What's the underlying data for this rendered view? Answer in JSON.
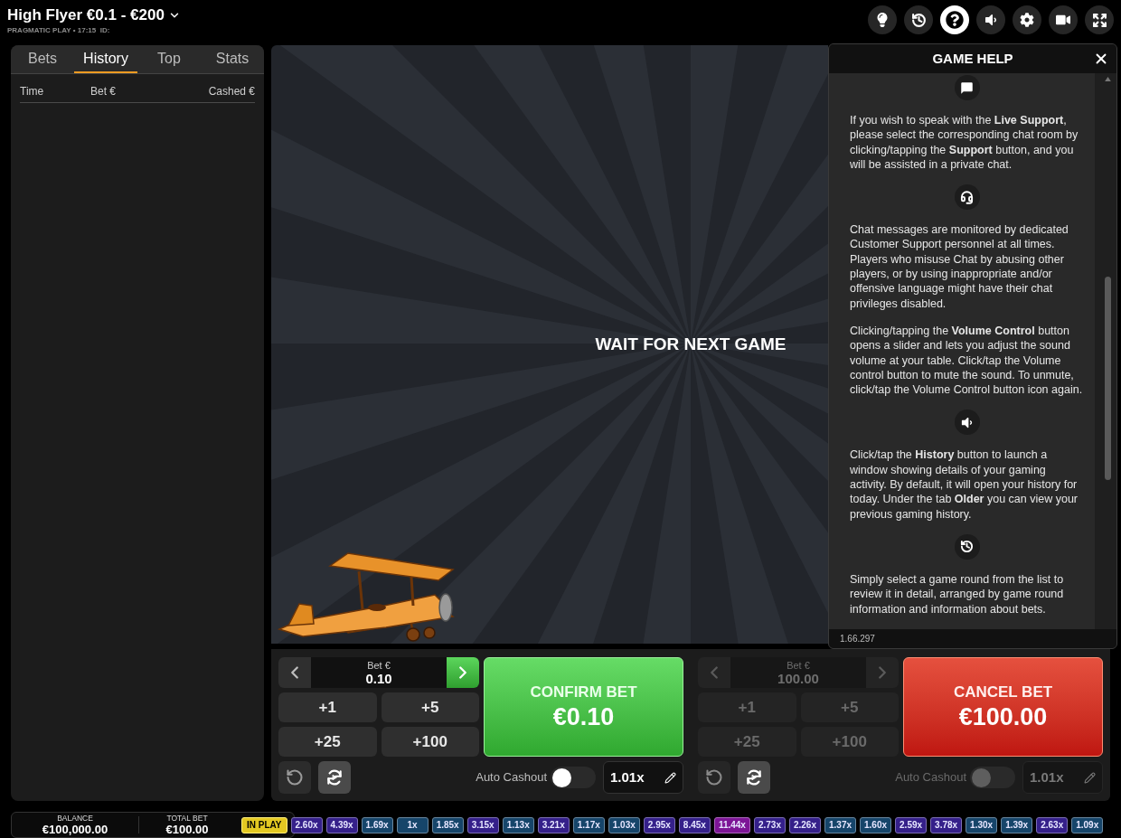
{
  "header": {
    "title": "High Flyer €0.1 - €200",
    "subtitle": "PRAGMATIC PLAY • 17:15  ID:"
  },
  "toolbar": [
    {
      "kind": "tips",
      "selected": false
    },
    {
      "kind": "history",
      "selected": false
    },
    {
      "kind": "help",
      "selected": true
    },
    {
      "kind": "sound",
      "selected": false
    },
    {
      "kind": "settings",
      "selected": false
    },
    {
      "kind": "video",
      "selected": false
    },
    {
      "kind": "fullscreen",
      "selected": false
    }
  ],
  "bets_panel": {
    "tabs": [
      {
        "label": "Bets",
        "selected": false
      },
      {
        "label": "History",
        "selected": true
      },
      {
        "label": "Top",
        "selected": false
      },
      {
        "label": "Stats",
        "selected": false
      }
    ],
    "columns": [
      "Time",
      "Bet €",
      "Cashed €"
    ]
  },
  "game": {
    "status": "WAIT FOR NEXT GAME"
  },
  "help": {
    "title": "GAME HELP",
    "items": [
      {
        "kind": "chat"
      },
      {
        "kind": "text",
        "text": "If you wish to speak with the **Live Support**, please select the corresponding chat room by clicking/tapping the **Support** button, and you will be assisted in a private chat."
      },
      {
        "kind": "support"
      },
      {
        "kind": "text",
        "text": "Chat messages are monitored by dedicated Customer Support personnel at all times. Players who misuse Chat by abusing other players, or by using inappropriate and/or offensive language might have their chat privileges disabled."
      },
      {
        "kind": "text",
        "text": "Clicking/tapping the **Volume Control** button opens a slider and lets you adjust the sound volume at your table. Click/tap the Volume control button to mute the sound. To unmute, click/tap the Volume Control button icon again."
      },
      {
        "kind": "sound"
      },
      {
        "kind": "text",
        "text": "Click/tap the **History** button to launch a window showing details of your gaming activity. By default, it will open your history for today. Under the tab **Older** you can view your previous gaming history."
      },
      {
        "kind": "history"
      },
      {
        "kind": "text",
        "text": "Simply select a game round from the list to review it in detail, arranged by game round information and information about bets."
      }
    ],
    "version": "1.66.297"
  },
  "bet_panels": [
    {
      "disabled": false,
      "stepper": {
        "label": "Bet €",
        "value": "0.10",
        "increase_highlighted": true
      },
      "chips": [
        "+1",
        "+5",
        "+25",
        "+100"
      ],
      "action": {
        "kind": "confirm",
        "title": "CONFIRM BET",
        "amount": "€0.10"
      },
      "auto_cashout": {
        "label": "Auto Cashout",
        "on": false,
        "value": "1.01x"
      }
    },
    {
      "disabled": true,
      "stepper": {
        "label": "Bet €",
        "value": "100.00",
        "increase_highlighted": false
      },
      "chips": [
        "+1",
        "+5",
        "+25",
        "+100"
      ],
      "action": {
        "kind": "cancel",
        "title": "CANCEL BET",
        "amount": "€100.00"
      },
      "auto_cashout": {
        "label": "Auto Cashout",
        "on": false,
        "value": "1.01x"
      }
    }
  ],
  "wallet": {
    "balance_label": "BALANCE",
    "balance": "€100,000.00",
    "total_bet_label": "TOTAL BET",
    "total_bet": "€100.00"
  },
  "round_history": {
    "status": "IN PLAY",
    "multipliers": [
      {
        "value": "2.60x",
        "color": "#35208a"
      },
      {
        "value": "4.39x",
        "color": "#35208a"
      },
      {
        "value": "1.69x",
        "color": "#16456a"
      },
      {
        "value": "1x",
        "color": "#16456a"
      },
      {
        "value": "1.85x",
        "color": "#16456a"
      },
      {
        "value": "3.15x",
        "color": "#35208a"
      },
      {
        "value": "1.13x",
        "color": "#16456a"
      },
      {
        "value": "3.21x",
        "color": "#35208a"
      },
      {
        "value": "1.17x",
        "color": "#16456a"
      },
      {
        "value": "1.03x",
        "color": "#16456a"
      },
      {
        "value": "2.95x",
        "color": "#35208a"
      },
      {
        "value": "8.45x",
        "color": "#35208a"
      },
      {
        "value": "11.44x",
        "color": "#7d1596"
      },
      {
        "value": "2.73x",
        "color": "#35208a"
      },
      {
        "value": "2.26x",
        "color": "#35208a"
      },
      {
        "value": "1.37x",
        "color": "#16456a"
      },
      {
        "value": "1.60x",
        "color": "#16456a"
      },
      {
        "value": "2.59x",
        "color": "#35208a"
      },
      {
        "value": "3.78x",
        "color": "#35208a"
      },
      {
        "value": "1.30x",
        "color": "#16456a"
      },
      {
        "value": "1.39x",
        "color": "#16456a"
      },
      {
        "value": "2.63x",
        "color": "#35208a"
      },
      {
        "value": "1.09x",
        "color": "#16456a"
      }
    ]
  }
}
